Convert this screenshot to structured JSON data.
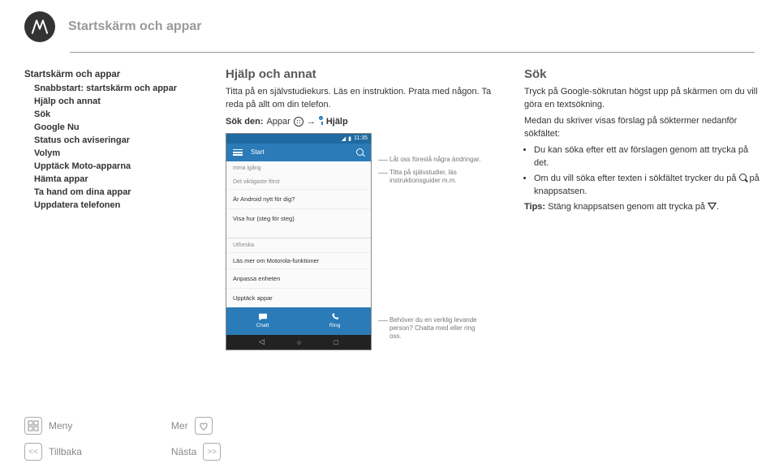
{
  "header": {
    "title": "Startskärm och appar"
  },
  "sidebar": {
    "top": "Startskärm och appar",
    "items": [
      "Snabbstart: startskärm och appar",
      "Hjälp och annat",
      "Sök",
      "Google Nu",
      "Status och aviseringar",
      "Volym",
      "Upptäck Moto-apparna",
      "Hämta appar",
      "Ta hand om dina appar",
      "Uppdatera telefonen"
    ]
  },
  "middle": {
    "heading": "Hjälp och annat",
    "p1": "Titta på en självstudiekurs. Läs en instruktion. Prata med någon. Ta reda på allt om din telefon.",
    "sokden_label": "Sök den:",
    "appar": "Appar",
    "arrow": "→",
    "hjalp": "Hjälp"
  },
  "phone": {
    "time": "11:35",
    "appbar_title": "Start",
    "row_small1": "mma igång",
    "row_small2": "Det viktigaste först",
    "row1": "Är Android nytt för dig?",
    "row2": "Visa hur (steg för steg)",
    "section_label": "Utforska",
    "row3": "Läs mer om Motorola-funktioner",
    "row4": "Anpassa enheten",
    "row5": "Upptäck appar",
    "actions": {
      "chat": "Chatt",
      "ring": "Ring"
    },
    "callouts": {
      "c1": "Låt oss föreslå några ändringar.",
      "c2": "Titta på självstudier, läs instruktionsguider m.m.",
      "c3": "Behöver du en verklig levande person? Chatta med eller ring oss."
    }
  },
  "right": {
    "heading": "Sök",
    "p1": "Tryck på Google-sökrutan högst upp på skärmen om du vill göra en textsökning.",
    "p2": "Medan du skriver visas förslag på söktermer nedanför sökfältet:",
    "b1": "Du kan söka efter ett av förslagen genom att trycka på det.",
    "b2a": "Om du vill söka efter texten i sökfältet trycker du på ",
    "b2b": " på knappsatsen.",
    "tips_label": "Tips:",
    "tips_text": " Stäng knappsatsen genom att trycka på "
  },
  "footer": {
    "meny": "Meny",
    "tillbaka": "Tillbaka",
    "mer": "Mer",
    "nasta": "Nästa"
  }
}
